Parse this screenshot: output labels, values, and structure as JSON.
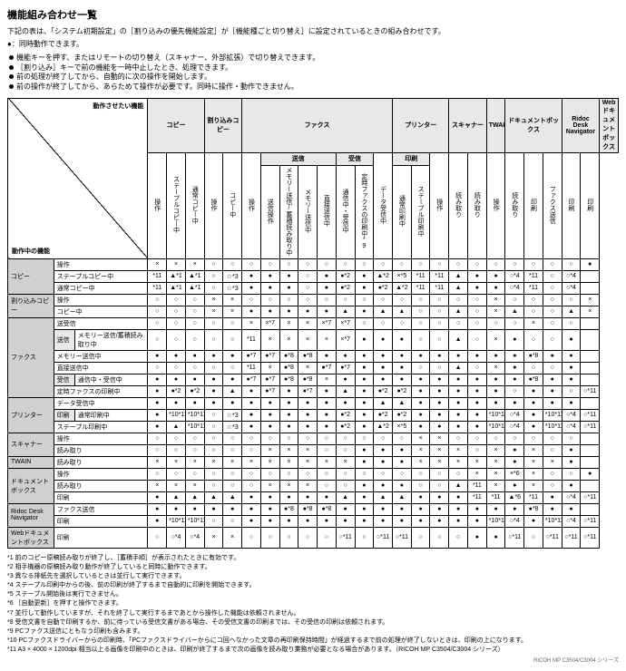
{
  "title": "機能組み合わせ一覧",
  "intro1": "下記の表は、「システム初期設定」の［割り込みの優先機能設定］が［機能種ごと切り替え］に設定されているときの組み合わせです。",
  "intro2": "●：同時動作できます。",
  "legend": [
    "機能キーを押す、またはリモートの切り替え（スキャナー、外部拡張）で切り替えできます。",
    "［割り込み］キーで前の機能を一時中止したとき、処理できます。",
    "前の処理が終了してから、自動的に次の操作を開始します。",
    "前の操作が終了してから、あらためて操作が必要です。同時に操作・動作できません。"
  ],
  "topHeader": "動作させたい機能",
  "leftHeader": "動作中の機能",
  "groupCols": [
    {
      "label": "コピー",
      "span": 3
    },
    {
      "label": "割り込みコピー",
      "span": 2
    },
    {
      "label": "ファクス",
      "span": 8
    },
    {
      "label": "プリンター",
      "span": 3
    },
    {
      "label": "スキャナー",
      "span": 2
    },
    {
      "label": "TWAIN",
      "span": 1
    },
    {
      "label": "ドキュメントボックス",
      "span": 3
    },
    {
      "label": "Ridoc Desk Navigator",
      "span": 2
    },
    {
      "label": "Webドキュメントボックス",
      "span": 1
    }
  ],
  "subGroups": {
    "fax": [
      {
        "label": "送信",
        "span": 4
      },
      {
        "label": "受信",
        "span": 2
      }
    ],
    "prt": [
      {
        "label": "印刷",
        "span": 2
      }
    ]
  },
  "colHeads": [
    "操作",
    "ステープルコピー中",
    "通常コピー中",
    "操作",
    "コピー中",
    "操作",
    "送信操作",
    "メモリー送信/蓄積読み取り中",
    "メモリー送信中",
    "直接送信中",
    "通信中・受信中",
    "定時ファクスの印刷中*9",
    "データ受信中",
    "通常印刷中",
    "ステープル印刷中",
    "操作",
    "読み取り",
    "読み取り",
    "操作",
    "読み取り",
    "印刷",
    "ファクス送信",
    "印刷",
    "印刷"
  ],
  "rows": [
    {
      "g": "コピー",
      "s": "",
      "l": "操作",
      "c": [
        "×",
        "×",
        "×",
        "○",
        "○",
        "○",
        "○",
        "○",
        "○",
        "○",
        "○",
        "○",
        "○",
        "○",
        "○",
        "○",
        "○",
        "○",
        "○",
        "○",
        "○",
        "○",
        "○",
        "●"
      ]
    },
    {
      "g": "",
      "s": "",
      "l": "ステープルコピー中",
      "c": [
        "*11",
        "▲*1",
        "▲*1",
        "○",
        "☆*3",
        "●",
        "●",
        "●",
        "○",
        "●",
        "●*2",
        "●",
        "▲*2",
        "×*5",
        "*11",
        "*11",
        "▲",
        "●",
        "●",
        "○*4",
        "*11",
        "○",
        "○*4",
        ""
      ]
    },
    {
      "g": "",
      "s": "",
      "l": "通常コピー中",
      "c": [
        "*11",
        "▲*1",
        "▲*1",
        "○",
        "☆*3",
        "●",
        "●",
        "●",
        "○",
        "●",
        "●*2",
        "●",
        "●*2",
        "▲*2",
        "*11",
        "*11",
        "▲",
        "●",
        "●",
        "○*4",
        "*11",
        "○",
        "○*4",
        ""
      ]
    },
    {
      "g": "割り込みコピー",
      "s": "",
      "l": "操作",
      "c": [
        "○",
        "○",
        "○",
        "×",
        "×",
        "○",
        "○",
        "○",
        "○",
        "○",
        "○",
        "○",
        "○",
        "○",
        "○",
        "○",
        "○",
        "○",
        "×",
        "○",
        "○",
        "○",
        "○",
        "×"
      ]
    },
    {
      "g": "",
      "s": "",
      "l": "コピー中",
      "c": [
        "○",
        "○",
        "○",
        "×",
        "×",
        "●",
        "●",
        "●",
        "●",
        "●",
        "▲",
        "●",
        "▲",
        "▲",
        "○",
        "○",
        "▲",
        "○",
        "×",
        "▲",
        "○",
        "○",
        "▲",
        "×"
      ]
    },
    {
      "g": "ファクス",
      "s": "",
      "l": "送受信",
      "c": [
        "○",
        "○",
        "○",
        "○",
        "○",
        "×",
        "×*7",
        "×",
        "×",
        "×*7",
        "×*7",
        "○",
        "○",
        "○",
        "○",
        "○",
        "○",
        "○",
        "○",
        "○",
        "×",
        "○",
        "○",
        ""
      ]
    },
    {
      "g": "",
      "s": "送信",
      "l": "メモリー送信/蓄積読み取り中",
      "c": [
        "○",
        "○",
        "○",
        "○",
        "○",
        "*11",
        "×",
        "×",
        "×",
        "×",
        "×*7",
        "●",
        "●",
        "●",
        "○",
        "○",
        "▲",
        "○",
        "×",
        "●",
        "○",
        "○",
        "●",
        ""
      ]
    },
    {
      "g": "",
      "s": "",
      "l": "メモリー送信中",
      "c": [
        "●",
        "●",
        "●",
        "●",
        "●",
        "●*7",
        "●*7",
        "●*8",
        "●*8",
        "●",
        "●",
        "●",
        "●",
        "●",
        "●",
        "●",
        "●",
        "●",
        "●",
        "●",
        "●*8",
        "●",
        "●",
        ""
      ]
    },
    {
      "g": "",
      "s": "",
      "l": "直接送信中",
      "c": [
        "○",
        "○",
        "○",
        "○",
        "○",
        "*11",
        "×",
        "●*8",
        "×",
        "●*7",
        "●*7",
        "●",
        "●",
        "●",
        "○",
        "○",
        "▲",
        "○",
        "×",
        "●",
        "○",
        "○",
        "●",
        ""
      ]
    },
    {
      "g": "",
      "s": "受信",
      "l": "通信中・受信中",
      "c": [
        "●",
        "●",
        "●",
        "●",
        "●",
        "●*7",
        "●*7",
        "●*8",
        "●*8",
        "×",
        "●",
        "●",
        "●",
        "●",
        "●",
        "●",
        "●",
        "●",
        "●",
        "●",
        "●*8",
        "●",
        "●",
        ""
      ]
    },
    {
      "g": "",
      "s": "",
      "l": "定時ファクスの印刷中",
      "c": [
        "●",
        "●*2",
        "●*2",
        "●",
        "▲",
        "●",
        "●*7",
        "●",
        "●*7",
        "●",
        "▲",
        "●",
        "●*2",
        "●*2",
        "●",
        "●",
        "●",
        "●",
        "●",
        "○",
        "●",
        "●",
        "○",
        "○*11"
      ]
    },
    {
      "g": "プリンター",
      "s": "",
      "l": "データ受信中",
      "c": [
        "●",
        "●",
        "●",
        "●",
        "●",
        "●",
        "●",
        "●",
        "●",
        "●",
        "●",
        "●",
        "▲",
        "▲",
        "●",
        "●",
        "●",
        "●",
        "●",
        "●",
        "●",
        "●",
        "●",
        ""
      ]
    },
    {
      "g": "",
      "s": "印刷",
      "l": "通常印刷中",
      "c": [
        "●",
        "*10*11",
        "*10*11",
        "○",
        "☆*3",
        "●",
        "●",
        "●",
        "●",
        "●",
        "●*2",
        "●",
        "●*2",
        "●*2",
        "●",
        "●",
        "●",
        "●",
        "*10*11",
        "○*4",
        "●",
        "*10*11",
        "○*4",
        "○*11"
      ]
    },
    {
      "g": "",
      "s": "",
      "l": "ステープル印刷中",
      "c": [
        "●",
        "▲",
        "*10*11",
        "○",
        "☆*3",
        "●",
        "●",
        "●",
        "●",
        "●",
        "●*2",
        "●",
        "▲*2",
        "×*5",
        "●",
        "●",
        "●",
        "●",
        "*10*11",
        "○*4",
        "●",
        "*10*11",
        "○*4",
        "○*11"
      ]
    },
    {
      "g": "スキャナー",
      "s": "",
      "l": "操作",
      "c": [
        "○",
        "○",
        "○",
        "○",
        "○",
        "○",
        "○",
        "○",
        "○",
        "○",
        "○",
        "○",
        "○",
        "○",
        "×",
        "×",
        "○",
        "○",
        "○",
        "○",
        "○",
        "○",
        "○",
        ""
      ]
    },
    {
      "g": "",
      "s": "",
      "l": "読み取り",
      "c": [
        "○",
        "○",
        "○",
        "○",
        "○",
        "○",
        "×",
        "×",
        "×",
        "○",
        "○",
        "●",
        "●",
        "●",
        "×",
        "×",
        "×",
        "○",
        "×",
        "●",
        "×",
        "○",
        "●",
        ""
      ]
    },
    {
      "g": "TWAIN",
      "s": "",
      "l": "読み取り",
      "c": [
        "×",
        "×",
        "×",
        "×",
        "×",
        "×",
        "×",
        "×",
        "×",
        "×",
        "×",
        "●",
        "●",
        "●",
        "×",
        "×",
        "×",
        "×",
        "×",
        "●",
        "×",
        "×",
        "●",
        ""
      ]
    },
    {
      "g": "ドキュメントボックス",
      "s": "",
      "l": "操作",
      "c": [
        "○",
        "○",
        "○",
        "○",
        "○",
        "○",
        "○",
        "○",
        "○",
        "○",
        "○",
        "○",
        "○",
        "○",
        "○",
        "○",
        "○",
        "×",
        "×",
        "×*6",
        "×",
        "○",
        "○",
        "●"
      ]
    },
    {
      "g": "",
      "s": "",
      "l": "読み取り",
      "c": [
        "×",
        "×",
        "×",
        "○",
        "○",
        "○",
        "×",
        "×",
        "×",
        "○",
        "○",
        "●",
        "●",
        "●",
        "○",
        "○",
        "▲",
        "*11",
        "×",
        "●",
        "×",
        "○",
        "●",
        ""
      ]
    },
    {
      "g": "",
      "s": "",
      "l": "印刷",
      "c": [
        "●",
        "▲",
        "▲",
        "▲",
        "▲",
        "●",
        "●",
        "●",
        "●",
        "●",
        "▲",
        "●",
        "▲",
        "▲",
        "●",
        "●",
        "●",
        "*11",
        "*11",
        "▲*6",
        "*11",
        "●",
        "○*4",
        "○*11"
      ]
    },
    {
      "g": "Ridoc Desk Navigator",
      "s": "",
      "l": "ファクス送信",
      "c": [
        "●",
        "●",
        "●",
        "●",
        "●",
        "●",
        "●",
        "●*8",
        "●*8",
        "●*8",
        "●",
        "●",
        "●",
        "●",
        "●",
        "●",
        "●",
        "●",
        "●",
        "●",
        "●*8",
        "●",
        "●",
        ""
      ]
    },
    {
      "g": "",
      "s": "",
      "l": "印刷",
      "c": [
        "●",
        "*10*11",
        "*10*11",
        "○",
        "○",
        "●",
        "●",
        "●",
        "●",
        "●",
        "●",
        "●",
        "●",
        "●",
        "●",
        "●",
        "●",
        "●",
        "*10*11",
        "○*4",
        "●",
        "*10*11",
        "○*4",
        "○*11"
      ]
    },
    {
      "g": "Webドキュメントボックス",
      "s": "",
      "l": "印刷",
      "c": [
        "○",
        "○*4",
        "○*4",
        "×",
        "×",
        "○",
        "○",
        "○",
        "○",
        "○",
        "○*11",
        "○",
        "○*11",
        "○*11",
        "○",
        "○",
        "○",
        "●",
        "●",
        "○*11",
        "○",
        "○*11",
        "○*11",
        "○*11"
      ]
    }
  ],
  "notes": [
    "*1 前のコピー原稿読み取りが終了し、［蓄積手順］が表示されたときに有効です。",
    "*2 相手機器の原稿読み取り動作が終了していると同時に動作できます。",
    "*3 異なる排紙先を選択しているときは並行して実行できます。",
    "*4 ステープル印刷中からの後、前の印刷が終了するまで自動的に印刷を開始できます。",
    "*5 ステープル開始後は実行できません。",
    "*6 ［自動更新］を押すと操作できます。",
    "*7 並行して動作していますが、それを終了して実行するまであとから操作した機能は依頼されません。",
    "*8 受信文書を自動で印刷するか、前に待っている受信文書がある場合、その受信文書の印刷までは、その受信の印刷は依頼されます。",
    "*9 PCファクス送信にともなう印刷も含みます。",
    "*10 PCファクスドライバーからの印刷時、「PCファクスドライバーからにコ回へなかった文章の再印刷保持時間」が経過するまで前の処理が終了しないときは、印刷の上になります。",
    "*11 A3 × 4000 × 1200dpi 相当以上る画像を印刷中のときは、印刷が終了するまで次の画像を読み取り業務が必要となる場合があります。（RICOH MP C3504/C3004 シリーズ）"
  ],
  "rightFoot": "RICOH MP C3504/C3004 シリーズ"
}
